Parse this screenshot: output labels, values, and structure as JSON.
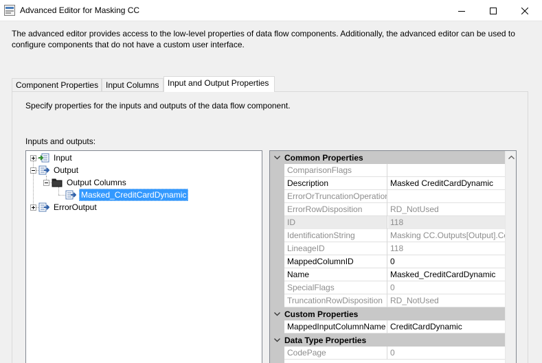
{
  "window": {
    "title": "Advanced Editor for Masking CC"
  },
  "description": "The advanced editor provides access to the low-level properties of data flow components. Additionally, the advanced editor can be used to configure components that do not have a custom user interface.",
  "tabs": [
    {
      "label": "Component Properties",
      "active": false
    },
    {
      "label": "Input Columns",
      "active": false
    },
    {
      "label": "Input and Output Properties",
      "active": true
    }
  ],
  "panel": {
    "description": "Specify properties for the inputs and outputs of the data flow component.",
    "inputs_outputs_label": "Inputs and outputs:"
  },
  "tree": {
    "input": "Input",
    "output": "Output",
    "output_columns": "Output Columns",
    "selected_column": "Masked_CreditCardDynamic",
    "error_output": "ErrorOutput"
  },
  "properties": {
    "common": {
      "header": "Common Properties",
      "rows": [
        {
          "name": "ComparisonFlags",
          "value": "",
          "readonly": true
        },
        {
          "name": "Description",
          "value": "Masked CreditCardDynamic",
          "readonly": false
        },
        {
          "name": "ErrorOrTruncationOperation",
          "value": "",
          "readonly": true
        },
        {
          "name": "ErrorRowDisposition",
          "value": "RD_NotUsed",
          "readonly": true
        },
        {
          "name": "ID",
          "value": "118",
          "readonly": true
        },
        {
          "name": "IdentificationString",
          "value": "Masking CC.Outputs[Output].Columns[Masked_CreditCardDynamic]",
          "readonly": true
        },
        {
          "name": "LineageID",
          "value": "118",
          "readonly": true
        },
        {
          "name": "MappedColumnID",
          "value": "0",
          "readonly": false
        },
        {
          "name": "Name",
          "value": "Masked_CreditCardDynamic",
          "readonly": false
        },
        {
          "name": "SpecialFlags",
          "value": "0",
          "readonly": true
        },
        {
          "name": "TruncationRowDisposition",
          "value": "RD_NotUsed",
          "readonly": true
        }
      ]
    },
    "custom": {
      "header": "Custom Properties",
      "rows": [
        {
          "name": "MappedInputColumnName",
          "value": "CreditCardDynamic",
          "readonly": false
        }
      ]
    },
    "datatype": {
      "header": "Data Type Properties",
      "rows": [
        {
          "name": "CodePage",
          "value": "0",
          "readonly": true
        }
      ]
    }
  },
  "colors": {
    "selection": "#3399ff",
    "category": "#c8c8c8",
    "readonly_text": "#8d8d8d"
  }
}
